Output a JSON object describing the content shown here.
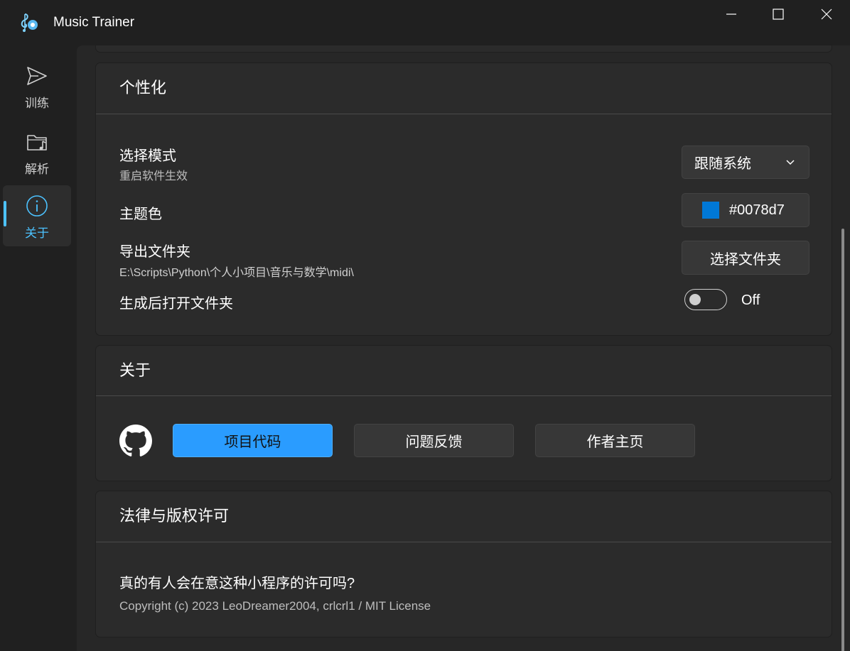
{
  "window": {
    "title": "Music Trainer",
    "controls": {
      "minimize": "minimize-icon",
      "maximize": "maximize-icon",
      "close": "close-icon"
    }
  },
  "sidebar": {
    "items": [
      {
        "label": "训练",
        "icon": "send-icon",
        "active": false
      },
      {
        "label": "解析",
        "icon": "music-folder-icon",
        "active": false
      },
      {
        "label": "关于",
        "icon": "info-icon",
        "active": true
      }
    ],
    "accent_color": "#4cc2ff"
  },
  "personalization": {
    "title": "个性化",
    "mode": {
      "label": "选择模式",
      "description": "重启软件生效",
      "selected": "跟随系统"
    },
    "theme_color": {
      "label": "主题色",
      "value": "#0078d7"
    },
    "export_folder": {
      "label": "导出文件夹",
      "path": "E:\\Scripts\\Python\\个人小项目\\音乐与数学\\midi\\",
      "button_label": "选择文件夹"
    },
    "open_after": {
      "label": "生成后打开文件夹",
      "state": "Off",
      "on": false
    }
  },
  "about": {
    "title": "关于",
    "icon": "github-icon",
    "buttons": [
      "项目代码",
      "问题反馈",
      "作者主页"
    ],
    "primary_color": "#2a9cff"
  },
  "legal": {
    "title": "法律与版权许可",
    "question": "真的有人会在意这种小程序的许可吗?",
    "copyright": "Copyright (c) 2023 LeoDreamer2004, crlcrl1 / MIT License"
  }
}
